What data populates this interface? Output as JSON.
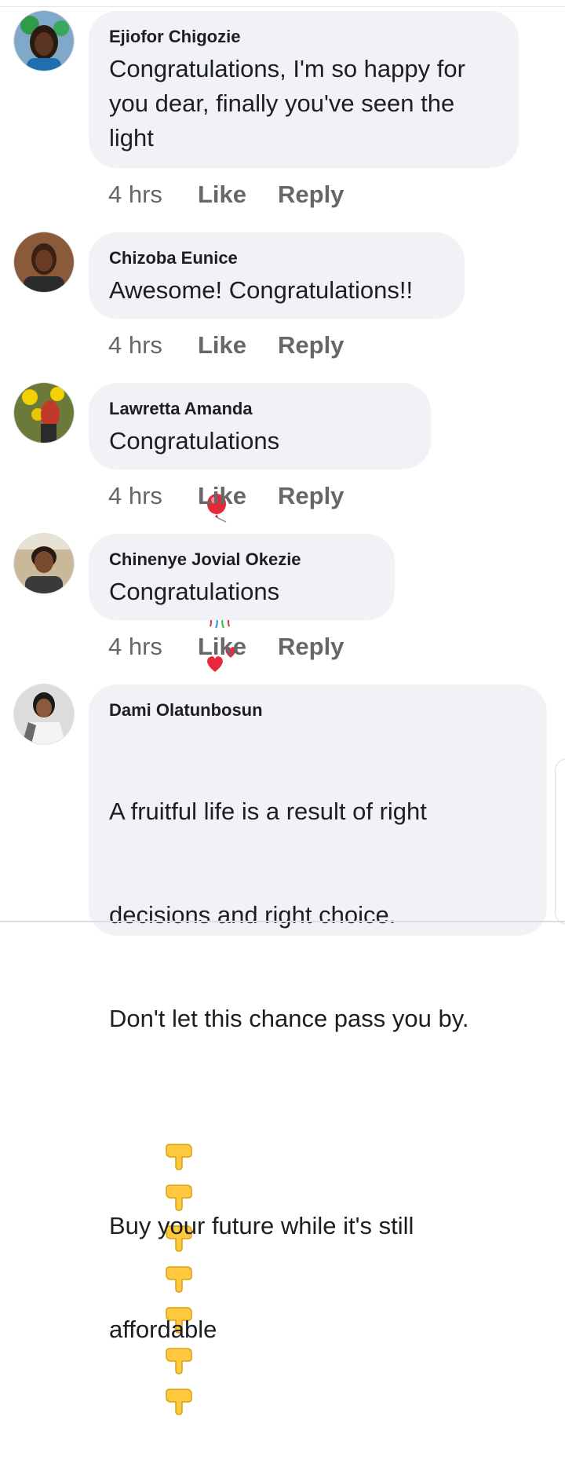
{
  "comments": [
    {
      "author": "Ejiofor Chigozie",
      "text": "Congratulations, I'm so happy for you dear, finally you've seen the light",
      "time": "4 hrs",
      "like": "Like",
      "reply": "Reply"
    },
    {
      "author": "Chizoba Eunice",
      "text": "Awesome! Congratulations!!",
      "time": "4 hrs",
      "like": "Like",
      "reply": "Reply"
    },
    {
      "author": "Lawretta Amanda",
      "text": "Congratulations",
      "emojis": [
        "balloon",
        "confetti-ball",
        "party-popper"
      ],
      "time": "4 hrs",
      "like": "Like",
      "reply": "Reply"
    },
    {
      "author": "Chinenye Jovial Okezie",
      "text": "Congratulations",
      "emojis": [
        "revolving-hearts",
        "revolving-hearts"
      ],
      "time": "4 hrs",
      "like": "Like",
      "reply": "Reply"
    },
    {
      "author": "Dami Olatunbosun",
      "text_lines": [
        "A fruitful life is a result of right",
        "decisions and right choice.",
        "Don't let this chance pass you by."
      ],
      "emoji_row": [
        "pointing-down",
        "pointing-down",
        "pointing-down",
        "pointing-down",
        "pointing-down",
        "pointing-down",
        "pointing-down"
      ],
      "text_lines_2": [
        "Buy your future while it's still",
        "affordable"
      ]
    }
  ],
  "colors": {
    "bubble": "#f0f2f5",
    "meta_text": "#65676b",
    "primary_text": "#1c1e21"
  }
}
